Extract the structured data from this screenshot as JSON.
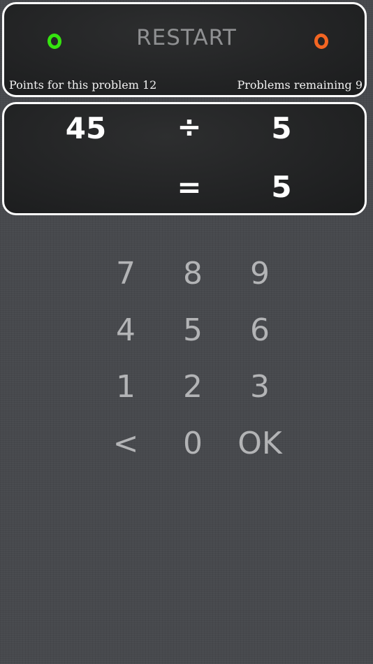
{
  "header": {
    "restart_label": "RESTART",
    "points_text": "Points for this problem 12",
    "remaining_text": "Problems remaining 9",
    "left_indicator_color": "#35e40f",
    "right_indicator_color": "#f26522"
  },
  "problem": {
    "operand_a": "45",
    "operator": "÷",
    "operand_b": "5",
    "equals": "=",
    "answer": "5"
  },
  "keypad": {
    "keys": [
      "7",
      "8",
      "9",
      "4",
      "5",
      "6",
      "1",
      "2",
      "3",
      "<",
      "0",
      "OK"
    ]
  }
}
